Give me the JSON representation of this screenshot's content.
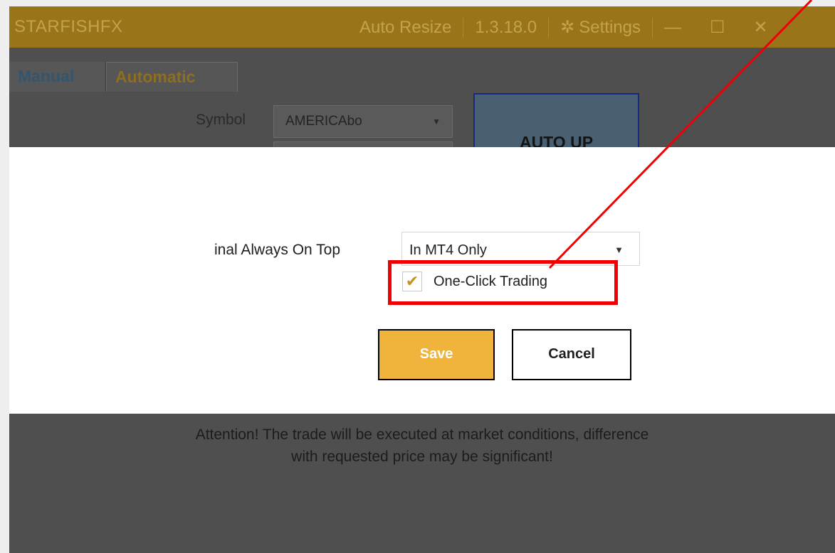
{
  "titlebar": {
    "app_title": "STARFISHFX",
    "auto_resize": "Auto Resize",
    "version": "1.3.18.0",
    "settings": "Settings",
    "minimize_glyph": "—",
    "maximize_glyph": "☐",
    "close_glyph": "✕"
  },
  "tabs": {
    "manual": "Manual",
    "automatic": "Automatic"
  },
  "form": {
    "symbol_label": "Symbol",
    "symbol_value": "AMERICAbo",
    "auto_up_label": "AUTO UP"
  },
  "dialog": {
    "always_on_top_label": "inal Always On Top",
    "always_on_top_value": "In MT4 Only",
    "one_click_label": "One-Click Trading",
    "one_click_checked": true,
    "checkmark": "✔",
    "save_label": "Save",
    "cancel_label": "Cancel"
  },
  "notice": {
    "line1": "Attention! The trade will be executed at market conditions, difference",
    "line2": "with requested price may be significant!"
  },
  "dropdown_glyph": "▼",
  "colors": {
    "highlight": "#f00000",
    "accent": "#f0b43c",
    "titlebar": "#9a7419"
  }
}
